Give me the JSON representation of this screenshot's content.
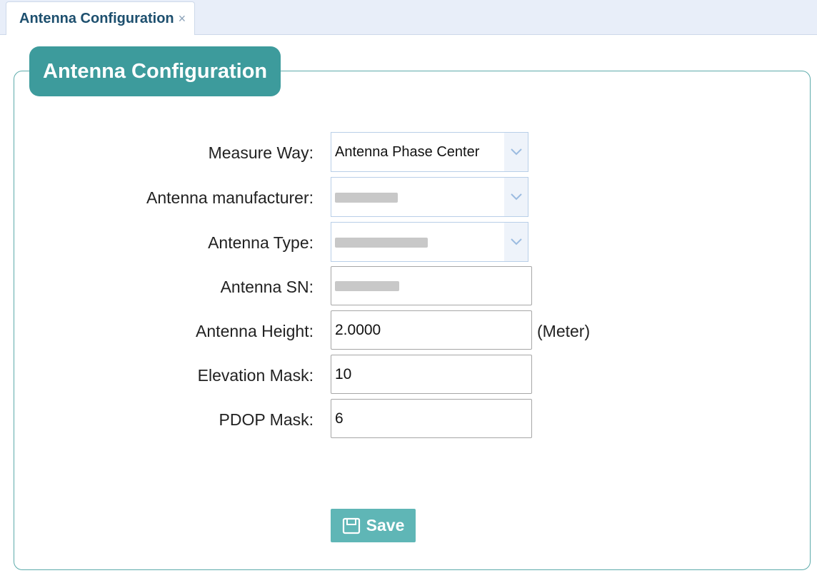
{
  "tab": {
    "label": "Antenna Configuration",
    "close_glyph": "×"
  },
  "panel": {
    "title": "Antenna Configuration"
  },
  "form": {
    "measure_way": {
      "label": "Measure Way:",
      "value": "Antenna Phase Center"
    },
    "manufacturer": {
      "label": "Antenna manufacturer:",
      "value": ""
    },
    "antenna_type": {
      "label": "Antenna Type:",
      "value": ""
    },
    "antenna_sn": {
      "label": "Antenna SN:",
      "value": ""
    },
    "antenna_height": {
      "label": "Antenna Height:",
      "value": "2.0000",
      "unit": "(Meter)"
    },
    "elevation_mask": {
      "label": "Elevation Mask:",
      "value": "10"
    },
    "pdop_mask": {
      "label": "PDOP Mask:",
      "value": "6"
    }
  },
  "actions": {
    "save_label": "Save"
  },
  "icons": {
    "dropdown": "chevron-down-icon",
    "save": "floppy-disk-icon",
    "close": "close-icon"
  },
  "colors": {
    "accent": "#3d9b9c",
    "button": "#5fb6b6",
    "tabbar": "#e8eef9"
  }
}
